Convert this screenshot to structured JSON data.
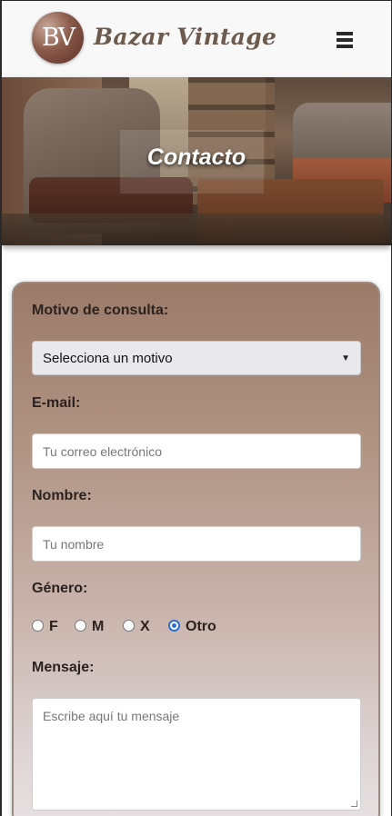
{
  "header": {
    "logo_text": "BV",
    "brand_name": "Bazar Vintage",
    "menu_icon": "hamburger-icon"
  },
  "hero": {
    "title": "Contacto"
  },
  "form": {
    "reason_label": "Motivo de consulta:",
    "reason_select": {
      "selected": "Selecciona un motivo"
    },
    "email_label": "E-mail:",
    "email_placeholder": "Tu correo electrónico",
    "name_label": "Nombre:",
    "name_placeholder": "Tu nombre",
    "gender_label": "Género:",
    "gender_options": [
      {
        "label": "F",
        "checked": false
      },
      {
        "label": "M",
        "checked": false
      },
      {
        "label": "X",
        "checked": false
      },
      {
        "label": "Otro",
        "checked": true
      }
    ],
    "message_label": "Mensaje:",
    "message_placeholder": "Escribe aquí tu mensaje"
  },
  "colors": {
    "brand_text": "#6d5a4e",
    "card_top": "#9b7a68",
    "card_bottom": "#e6e1e3",
    "radio_accent": "#2d6fd6"
  }
}
